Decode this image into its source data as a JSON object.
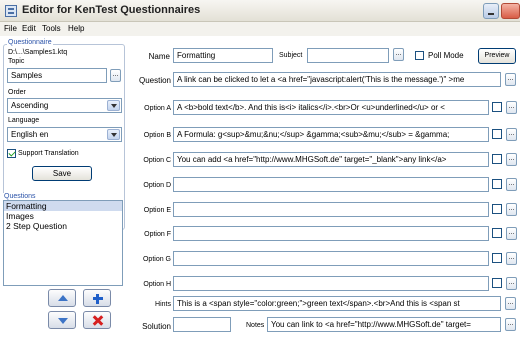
{
  "window": {
    "title": "Editor for KenTest Questionnaires"
  },
  "menu": [
    "File",
    "Edit",
    "Tools",
    "Help"
  ],
  "left": {
    "questionnaire_group": "Questionnaire",
    "file_path": "D:\\...\\Samples1.ktq",
    "topic_label": "Topic",
    "topic_value": "Samples",
    "order_label": "Order",
    "order_value": "Ascending",
    "language_label": "Language",
    "language_value": "English en",
    "support_translation": "Support Translation",
    "save_label": "Save",
    "questions_group": "Questions",
    "questions": [
      "Formatting",
      "Images",
      "2 Step Question"
    ]
  },
  "form": {
    "name_label": "Name",
    "name_value": "Formatting",
    "subject_label": "Subject",
    "subject_value": "",
    "poll_mode_label": "Poll Mode",
    "preview_label": "Preview",
    "question_label": "Question",
    "question_value": "A link can be clicked to let a <a href=\"javascript:alert('This is the message.')\" >me",
    "options": [
      {
        "label": "Option A",
        "value": "A <b>bold text</b>. And this is<i> italics</i>.<br>Or <u>underlined</u> or <"
      },
      {
        "label": "Option B",
        "value": "A Formula: g<sup>&mu;&nu;</sup> &gamma;<sub>&mu;</sub> = &gamma;"
      },
      {
        "label": "Option C",
        "value": "You can add <a href=\"http://www.MHGSoft.de\" target=\"_blank\">any link</a>"
      },
      {
        "label": "Option D",
        "value": ""
      },
      {
        "label": "Option E",
        "value": ""
      },
      {
        "label": "Option F",
        "value": ""
      },
      {
        "label": "Option G",
        "value": ""
      },
      {
        "label": "Option H",
        "value": ""
      }
    ],
    "hints_label": "Hints",
    "hints_value": "This is a <span style=\"color:green;\">green text</span>.<br>And this is <span st",
    "solution_label": "Solution",
    "solution_value": "",
    "notes_label": "Notes",
    "notes_value": "You can link to <a href=\"http://www.MHGSoft.de\" target="
  },
  "icons": {
    "move_up": "arrow-up-icon",
    "add": "plus-icon",
    "move_down": "arrow-down-icon",
    "delete": "x-icon"
  },
  "colors": {
    "group_title": "#2a52a8",
    "add": "#1f5fc9",
    "delete": "#d61f1f"
  }
}
